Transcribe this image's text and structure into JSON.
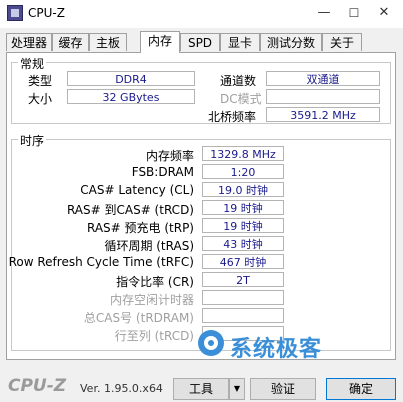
{
  "window": {
    "title": "CPU-Z",
    "minimize": "—",
    "maximize": "☐",
    "close": "✕"
  },
  "tabs": [
    {
      "label": "处理器"
    },
    {
      "label": "缓存"
    },
    {
      "label": "主板"
    },
    {
      "label": "内存"
    },
    {
      "label": "SPD"
    },
    {
      "label": "显卡"
    },
    {
      "label": "测试分数"
    },
    {
      "label": "关于"
    }
  ],
  "active_tab": "内存",
  "general": {
    "title": "常规",
    "type_label": "类型",
    "type_value": "DDR4",
    "size_label": "大小",
    "size_value": "32 GBytes",
    "channel_label": "通道数",
    "channel_value": "双通道",
    "dc_label": "DC模式",
    "dc_value": "",
    "nb_label": "北桥频率",
    "nb_value": "3591.2 MHz"
  },
  "timings": {
    "title": "时序",
    "rows": [
      {
        "label": "内存频率",
        "value": "1329.8 MHz",
        "dim": false
      },
      {
        "label": "FSB:DRAM",
        "value": "1:20",
        "dim": false
      },
      {
        "label": "CAS# Latency (CL)",
        "value": "19.0 时钟",
        "dim": false
      },
      {
        "label": "RAS# 到CAS# (tRCD)",
        "value": "19 时钟",
        "dim": false
      },
      {
        "label": "RAS# 预充电 (tRP)",
        "value": "19 时钟",
        "dim": false
      },
      {
        "label": "循环周期 (tRAS)",
        "value": "43 时钟",
        "dim": false
      },
      {
        "label": "Row Refresh Cycle Time (tRFC)",
        "value": "467 时钟",
        "dim": false
      },
      {
        "label": "指令比率 (CR)",
        "value": "2T",
        "dim": false
      },
      {
        "label": "内存空闲计时器",
        "value": "",
        "dim": true
      },
      {
        "label": "总CAS号 (tRDRAM)",
        "value": "",
        "dim": true
      },
      {
        "label": "行至列 (tRCD)",
        "value": "",
        "dim": true
      }
    ]
  },
  "footer": {
    "logo": "CPU-Z",
    "version": "Ver. 1.95.0.x64",
    "tools_label": "工具",
    "validate_label": "验证",
    "ok_label": "确定"
  },
  "watermark": {
    "text": "系统极客"
  }
}
